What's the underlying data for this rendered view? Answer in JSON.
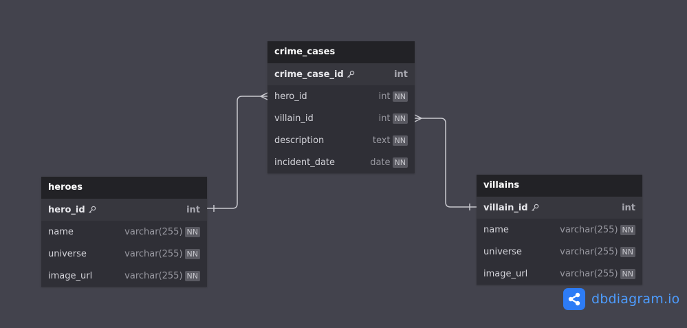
{
  "tables": {
    "crime_cases": {
      "title": "crime_cases",
      "columns": [
        {
          "name": "crime_case_id",
          "type": "int",
          "pk": true,
          "nn": false
        },
        {
          "name": "hero_id",
          "type": "int",
          "pk": false,
          "nn": true
        },
        {
          "name": "villain_id",
          "type": "int",
          "pk": false,
          "nn": true
        },
        {
          "name": "description",
          "type": "text",
          "pk": false,
          "nn": true
        },
        {
          "name": "incident_date",
          "type": "date",
          "pk": false,
          "nn": true
        }
      ]
    },
    "heroes": {
      "title": "heroes",
      "columns": [
        {
          "name": "hero_id",
          "type": "int",
          "pk": true,
          "nn": false
        },
        {
          "name": "name",
          "type": "varchar(255)",
          "pk": false,
          "nn": true
        },
        {
          "name": "universe",
          "type": "varchar(255)",
          "pk": false,
          "nn": true
        },
        {
          "name": "image_url",
          "type": "varchar(255)",
          "pk": false,
          "nn": true
        }
      ]
    },
    "villains": {
      "title": "villains",
      "columns": [
        {
          "name": "villain_id",
          "type": "int",
          "pk": true,
          "nn": false
        },
        {
          "name": "name",
          "type": "varchar(255)",
          "pk": false,
          "nn": true
        },
        {
          "name": "universe",
          "type": "varchar(255)",
          "pk": false,
          "nn": true
        },
        {
          "name": "image_url",
          "type": "varchar(255)",
          "pk": false,
          "nn": true
        }
      ]
    }
  },
  "nn_label": "NN",
  "relationships": [
    {
      "from": "heroes.hero_id",
      "to": "crime_cases.hero_id",
      "from_card": "one",
      "to_card": "many"
    },
    {
      "from": "villains.villain_id",
      "to": "crime_cases.villain_id",
      "from_card": "one",
      "to_card": "many"
    }
  ],
  "brand": {
    "name": "dbdiagram",
    "suffix": ".io",
    "logo_icon": "share-icon"
  },
  "colors": {
    "background": "#43434d",
    "header": "#222226",
    "body": "#2f2f36",
    "link": "#c9c9cf",
    "brand": "#2d7cf6"
  }
}
